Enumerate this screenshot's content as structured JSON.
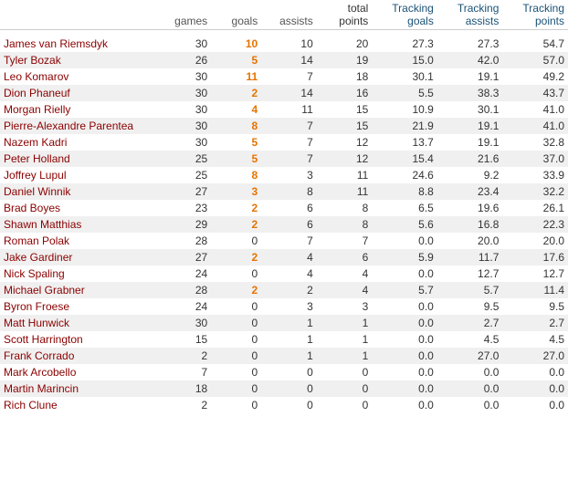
{
  "headers": {
    "name": "",
    "games": "games",
    "goals": "goals",
    "assists": "assists",
    "total_points": "total\npoints",
    "tracking_goals": "Tracking\ngoals",
    "tracking_assists": "Tracking\nassists",
    "tracking_points": "Tracking\npoints"
  },
  "players": [
    {
      "name": "James van Riemsdyk",
      "games": 30,
      "goals": 10,
      "assists": 10,
      "total_points": 20,
      "tracking_goals": 27.3,
      "tracking_assists": 27.3,
      "tracking_points": 54.7,
      "goal_highlight": true
    },
    {
      "name": "Tyler Bozak",
      "games": 26,
      "goals": 5,
      "assists": 14,
      "total_points": 19,
      "tracking_goals": 15.0,
      "tracking_assists": 42.0,
      "tracking_points": 57.0
    },
    {
      "name": "Leo Komarov",
      "games": 30,
      "goals": 11,
      "assists": 7,
      "total_points": 18,
      "tracking_goals": 30.1,
      "tracking_assists": 19.1,
      "tracking_points": 49.2,
      "goal_highlight": true
    },
    {
      "name": "Dion Phaneuf",
      "games": 30,
      "goals": 2,
      "assists": 14,
      "total_points": 16,
      "tracking_goals": 5.5,
      "tracking_assists": 38.3,
      "tracking_points": 43.7
    },
    {
      "name": "Morgan Rielly",
      "games": 30,
      "goals": 4,
      "assists": 11,
      "total_points": 15,
      "tracking_goals": 10.9,
      "tracking_assists": 30.1,
      "tracking_points": 41.0
    },
    {
      "name": "Pierre-Alexandre Parentea",
      "games": 30,
      "goals": 8,
      "assists": 7,
      "total_points": 15,
      "tracking_goals": 21.9,
      "tracking_assists": 19.1,
      "tracking_points": 41.0
    },
    {
      "name": "Nazem Kadri",
      "games": 30,
      "goals": 5,
      "assists": 7,
      "total_points": 12,
      "tracking_goals": 13.7,
      "tracking_assists": 19.1,
      "tracking_points": 32.8
    },
    {
      "name": "Peter Holland",
      "games": 25,
      "goals": 5,
      "assists": 7,
      "total_points": 12,
      "tracking_goals": 15.4,
      "tracking_assists": 21.6,
      "tracking_points": 37.0
    },
    {
      "name": "Joffrey Lupul",
      "games": 25,
      "goals": 8,
      "assists": 3,
      "total_points": 11,
      "tracking_goals": 24.6,
      "tracking_assists": 9.2,
      "tracking_points": 33.9
    },
    {
      "name": "Daniel Winnik",
      "games": 27,
      "goals": 3,
      "assists": 8,
      "total_points": 11,
      "tracking_goals": 8.8,
      "tracking_assists": 23.4,
      "tracking_points": 32.2
    },
    {
      "name": "Brad Boyes",
      "games": 23,
      "goals": 2,
      "assists": 6,
      "total_points": 8,
      "tracking_goals": 6.5,
      "tracking_assists": 19.6,
      "tracking_points": 26.1
    },
    {
      "name": "Shawn Matthias",
      "games": 29,
      "goals": 2,
      "assists": 6,
      "total_points": 8,
      "tracking_goals": 5.6,
      "tracking_assists": 16.8,
      "tracking_points": 22.3
    },
    {
      "name": "Roman Polak",
      "games": 28,
      "goals": 0,
      "assists": 7,
      "total_points": 7,
      "tracking_goals": 0.0,
      "tracking_assists": 20.0,
      "tracking_points": 20.0
    },
    {
      "name": "Jake Gardiner",
      "games": 27,
      "goals": 2,
      "assists": 4,
      "total_points": 6,
      "tracking_goals": 5.9,
      "tracking_assists": 11.7,
      "tracking_points": 17.6
    },
    {
      "name": "Nick Spaling",
      "games": 24,
      "goals": 0,
      "assists": 4,
      "total_points": 4,
      "tracking_goals": 0.0,
      "tracking_assists": 12.7,
      "tracking_points": 12.7
    },
    {
      "name": "Michael Grabner",
      "games": 28,
      "goals": 2,
      "assists": 2,
      "total_points": 4,
      "tracking_goals": 5.7,
      "tracking_assists": 5.7,
      "tracking_points": 11.4
    },
    {
      "name": "Byron Froese",
      "games": 24,
      "goals": 0,
      "assists": 3,
      "total_points": 3,
      "tracking_goals": 0.0,
      "tracking_assists": 9.5,
      "tracking_points": 9.5
    },
    {
      "name": "Matt Hunwick",
      "games": 30,
      "goals": 0,
      "assists": 1,
      "total_points": 1,
      "tracking_goals": 0.0,
      "tracking_assists": 2.7,
      "tracking_points": 2.7
    },
    {
      "name": "Scott Harrington",
      "games": 15,
      "goals": 0,
      "assists": 1,
      "total_points": 1,
      "tracking_goals": 0.0,
      "tracking_assists": 4.5,
      "tracking_points": 4.5
    },
    {
      "name": "Frank Corrado",
      "games": 2,
      "goals": 0,
      "assists": 1,
      "total_points": 1,
      "tracking_goals": 0.0,
      "tracking_assists": 27.0,
      "tracking_points": 27.0
    },
    {
      "name": "Mark Arcobello",
      "games": 7,
      "goals": 0,
      "assists": 0,
      "total_points": 0,
      "tracking_goals": 0.0,
      "tracking_assists": 0.0,
      "tracking_points": 0.0
    },
    {
      "name": "Martin Marincin",
      "games": 18,
      "goals": 0,
      "assists": 0,
      "total_points": 0,
      "tracking_goals": 0.0,
      "tracking_assists": 0.0,
      "tracking_points": 0.0
    },
    {
      "name": "Rich Clune",
      "games": 2,
      "goals": 0,
      "assists": 0,
      "total_points": 0,
      "tracking_goals": 0.0,
      "tracking_assists": 0.0,
      "tracking_points": 0.0
    }
  ]
}
